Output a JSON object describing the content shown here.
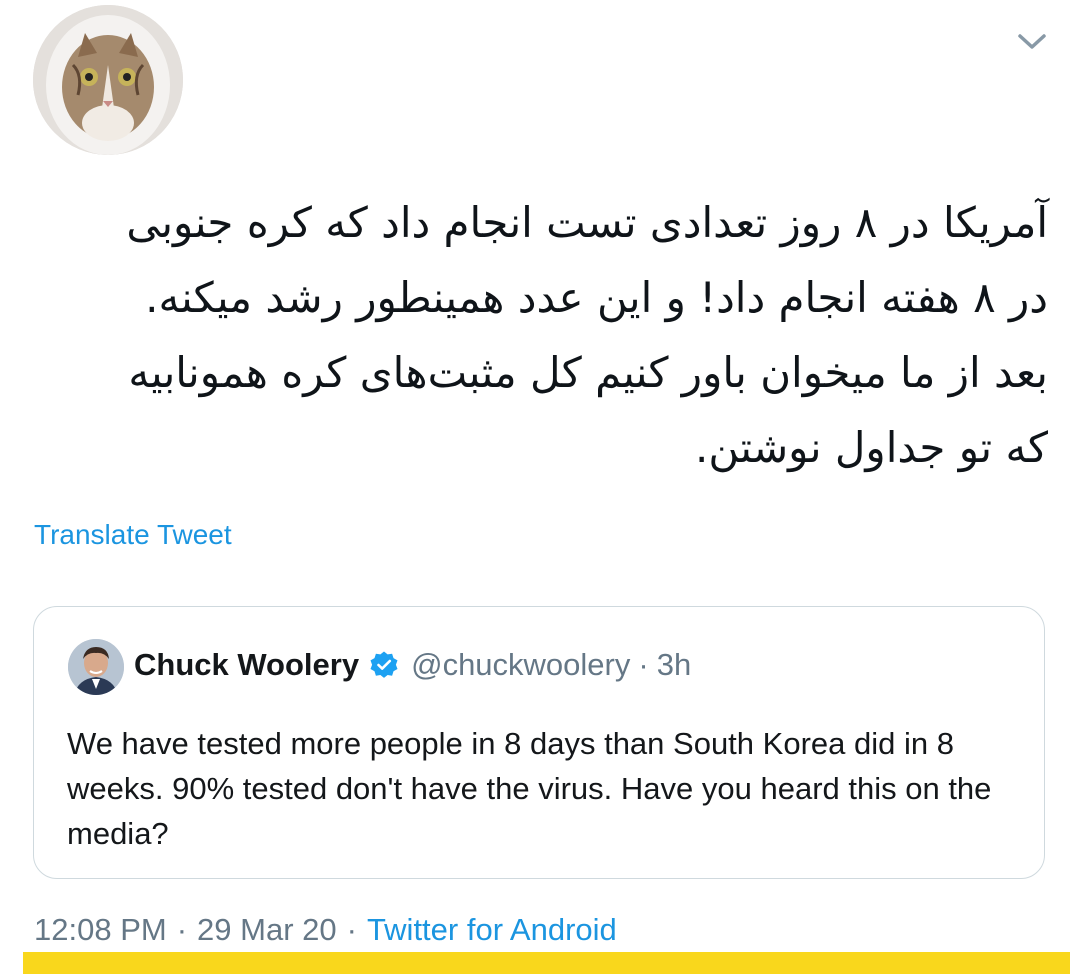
{
  "tweet": {
    "text": "آمریکا در ۸ روز تعدادی تست انجام داد که کره جنوبی\nدر ۸ هفته انجام داد! و این عدد همینطور رشد میکنه.\nبعد از ما میخوان باور کنیم کل مثبت‌های کره همونابیه\nکه تو جداول نوشتن.",
    "translate_label": "Translate Tweet",
    "time": "12:08 PM",
    "date": "29 Mar 20",
    "separator": "·",
    "source": "Twitter for Android"
  },
  "quoted": {
    "name": "Chuck Woolery",
    "handle": "@chuckwoolery",
    "separator": "·",
    "time": "3h",
    "text": "We have tested more people in 8 days than South Korea did in 8 weeks. 90% tested don't have the virus. Have you heard this on the media?"
  },
  "colors": {
    "link": "#1b95e0",
    "muted": "#657786",
    "text": "#14171a",
    "highlight": "#f9d71c"
  },
  "icons": {
    "caret": "chevron-down-icon",
    "verified": "verified-badge-icon"
  }
}
